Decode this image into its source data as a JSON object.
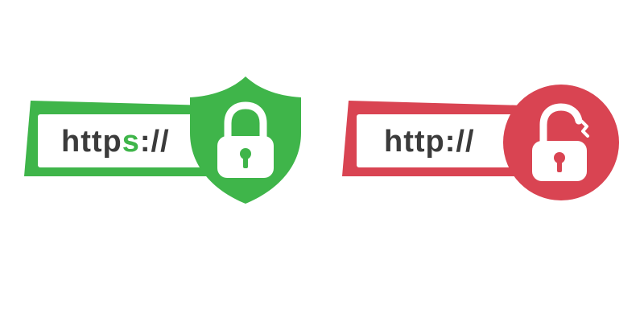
{
  "secure": {
    "scheme_prefix": "http",
    "scheme_accent": "s",
    "scheme_suffix": "://",
    "color": "#3fb54a",
    "icon": "shield-locked-padlock-icon"
  },
  "insecure": {
    "scheme": "http://",
    "color": "#d94452",
    "icon": "circle-broken-padlock-icon"
  },
  "text_color": "#3b3b3b"
}
